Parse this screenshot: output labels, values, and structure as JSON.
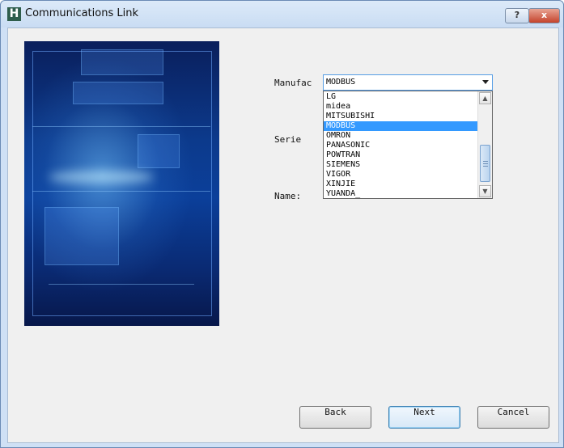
{
  "window": {
    "title": "Communications Link",
    "app_icon_letter": "H",
    "help_label": "?",
    "close_label": "x"
  },
  "form": {
    "manufacturer_label": "Manufac",
    "series_label": "Serie",
    "name_label": "Name:",
    "manufacturer_selected": "MODBUS"
  },
  "dropdown": {
    "items": [
      "LG",
      "midea",
      "MITSUBISHI",
      "MODBUS",
      "OMRON",
      "PANASONIC",
      "POWTRAN",
      "SIEMENS",
      "VIGOR",
      "XINJIE",
      "YUANDA_"
    ],
    "selected_index": 3,
    "scroll_up_icon": "arrow-up-icon",
    "scroll_down_icon": "arrow-down-icon"
  },
  "buttons": {
    "back": "Back",
    "next": "Next",
    "cancel": "Cancel"
  }
}
